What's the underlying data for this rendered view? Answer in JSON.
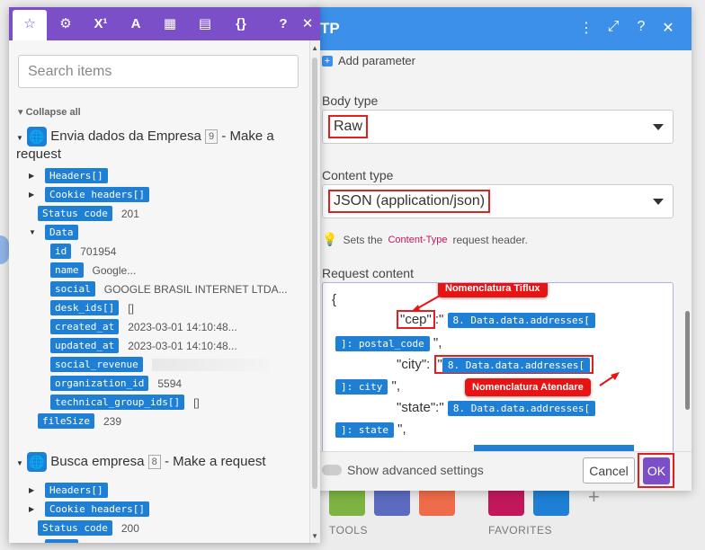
{
  "panel": {
    "tabs": [
      {
        "icon": "star-icon",
        "glyph": "☆"
      },
      {
        "icon": "gear-icon",
        "glyph": "⚙"
      },
      {
        "icon": "superscript-icon",
        "glyph": "X¹"
      },
      {
        "icon": "text-icon",
        "glyph": "A"
      },
      {
        "icon": "calendar-icon",
        "glyph": "▦"
      },
      {
        "icon": "table-icon",
        "glyph": "▤"
      },
      {
        "icon": "braces-icon",
        "glyph": "{}"
      },
      {
        "icon": "help-icon",
        "glyph": "?"
      },
      {
        "icon": "close-icon",
        "glyph": "✕"
      }
    ],
    "search_placeholder": "Search items",
    "collapse_all": "Collapse all",
    "modules": [
      {
        "title": "Envia dados da Empresa",
        "number": "9",
        "suffix": "- Make a request",
        "rows": [
          {
            "key": "Headers[]",
            "value": "",
            "expandable": true
          },
          {
            "key": "Cookie headers[]",
            "value": "",
            "expandable": true
          },
          {
            "key": "Status code",
            "value": "201",
            "expandable": false
          },
          {
            "key": "Data",
            "value": "",
            "expandable": true,
            "expanded": true
          },
          {
            "key": "id",
            "value": "701954",
            "child": true
          },
          {
            "key": "name",
            "value": "Google...",
            "child": true
          },
          {
            "key": "social",
            "value": "GOOGLE BRASIL INTERNET LTDA...",
            "child": true
          },
          {
            "key": "desk_ids[]",
            "value": "[]",
            "child": true
          },
          {
            "key": "created_at",
            "value": "2023-03-01 14:10:48...",
            "child": true
          },
          {
            "key": "updated_at",
            "value": "2023-03-01 14:10:48...",
            "child": true
          },
          {
            "key": "social_revenue",
            "value": "",
            "child": true
          },
          {
            "key": "organization_id",
            "value": "5594",
            "child": true
          },
          {
            "key": "technical_group_ids[]",
            "value": "[]",
            "child": true
          },
          {
            "key": "fileSize",
            "value": "239",
            "expandable": false
          }
        ]
      },
      {
        "title": "Busca empresa",
        "number": "8",
        "suffix": "- Make a request",
        "rows": [
          {
            "key": "Headers[]",
            "value": "",
            "expandable": true
          },
          {
            "key": "Cookie headers[]",
            "value": "",
            "expandable": true
          },
          {
            "key": "Status code",
            "value": "200",
            "expandable": false
          },
          {
            "key": "Data",
            "value": "",
            "expandable": true,
            "expanded": true
          }
        ]
      }
    ]
  },
  "dialog": {
    "title": "TP",
    "header_icons": [
      {
        "icon": "more-vertical-icon",
        "glyph": "⋮"
      },
      {
        "icon": "expand-icon",
        "glyph": "⤢"
      },
      {
        "icon": "help-icon",
        "glyph": "?"
      },
      {
        "icon": "close-icon",
        "glyph": "✕"
      }
    ],
    "add_parameter": "Add parameter",
    "body_type_label": "Body type",
    "body_type_value": "Raw",
    "content_type_label": "Content type",
    "content_type_value": "JSON (application/json)",
    "hint_prefix": "Sets the",
    "hint_highlight": "Content-Type",
    "hint_suffix": "request header.",
    "request_content_label": "Request content",
    "editor": {
      "open_brace": "{",
      "cep_key": "\"cep\"",
      "cep_sep": ":\"",
      "cep_pill_1": "8. Data.data.addresses[",
      "cep_pill_2": "]: postal_code",
      "cep_end": "\",",
      "city_key": "\"city\":",
      "city_quote": "\"",
      "city_pill_1": "8. Data.data.addresses[",
      "city_pill_2": "]: city",
      "city_end": "\",",
      "state_key": "\"state\":\"",
      "state_pill_1": "8. Data.data.addresses[",
      "state_pill_2": "]: state",
      "state_end": "\","
    },
    "callout_tiflux": "Nomenclatura Tiflux",
    "callout_atendare": "Nomenclatura Atendare",
    "advanced_settings": "Show advanced settings",
    "cancel": "Cancel",
    "ok": "OK"
  },
  "background": {
    "tools_label": "TOOLS",
    "favorites_label": "FAVORITES",
    "plus": "+"
  },
  "colors": {
    "accent_purple": "#7b4fc8",
    "header_blue": "#3c90ea",
    "pill_blue": "#1e7fd4",
    "annotation_red": "#e81414"
  }
}
